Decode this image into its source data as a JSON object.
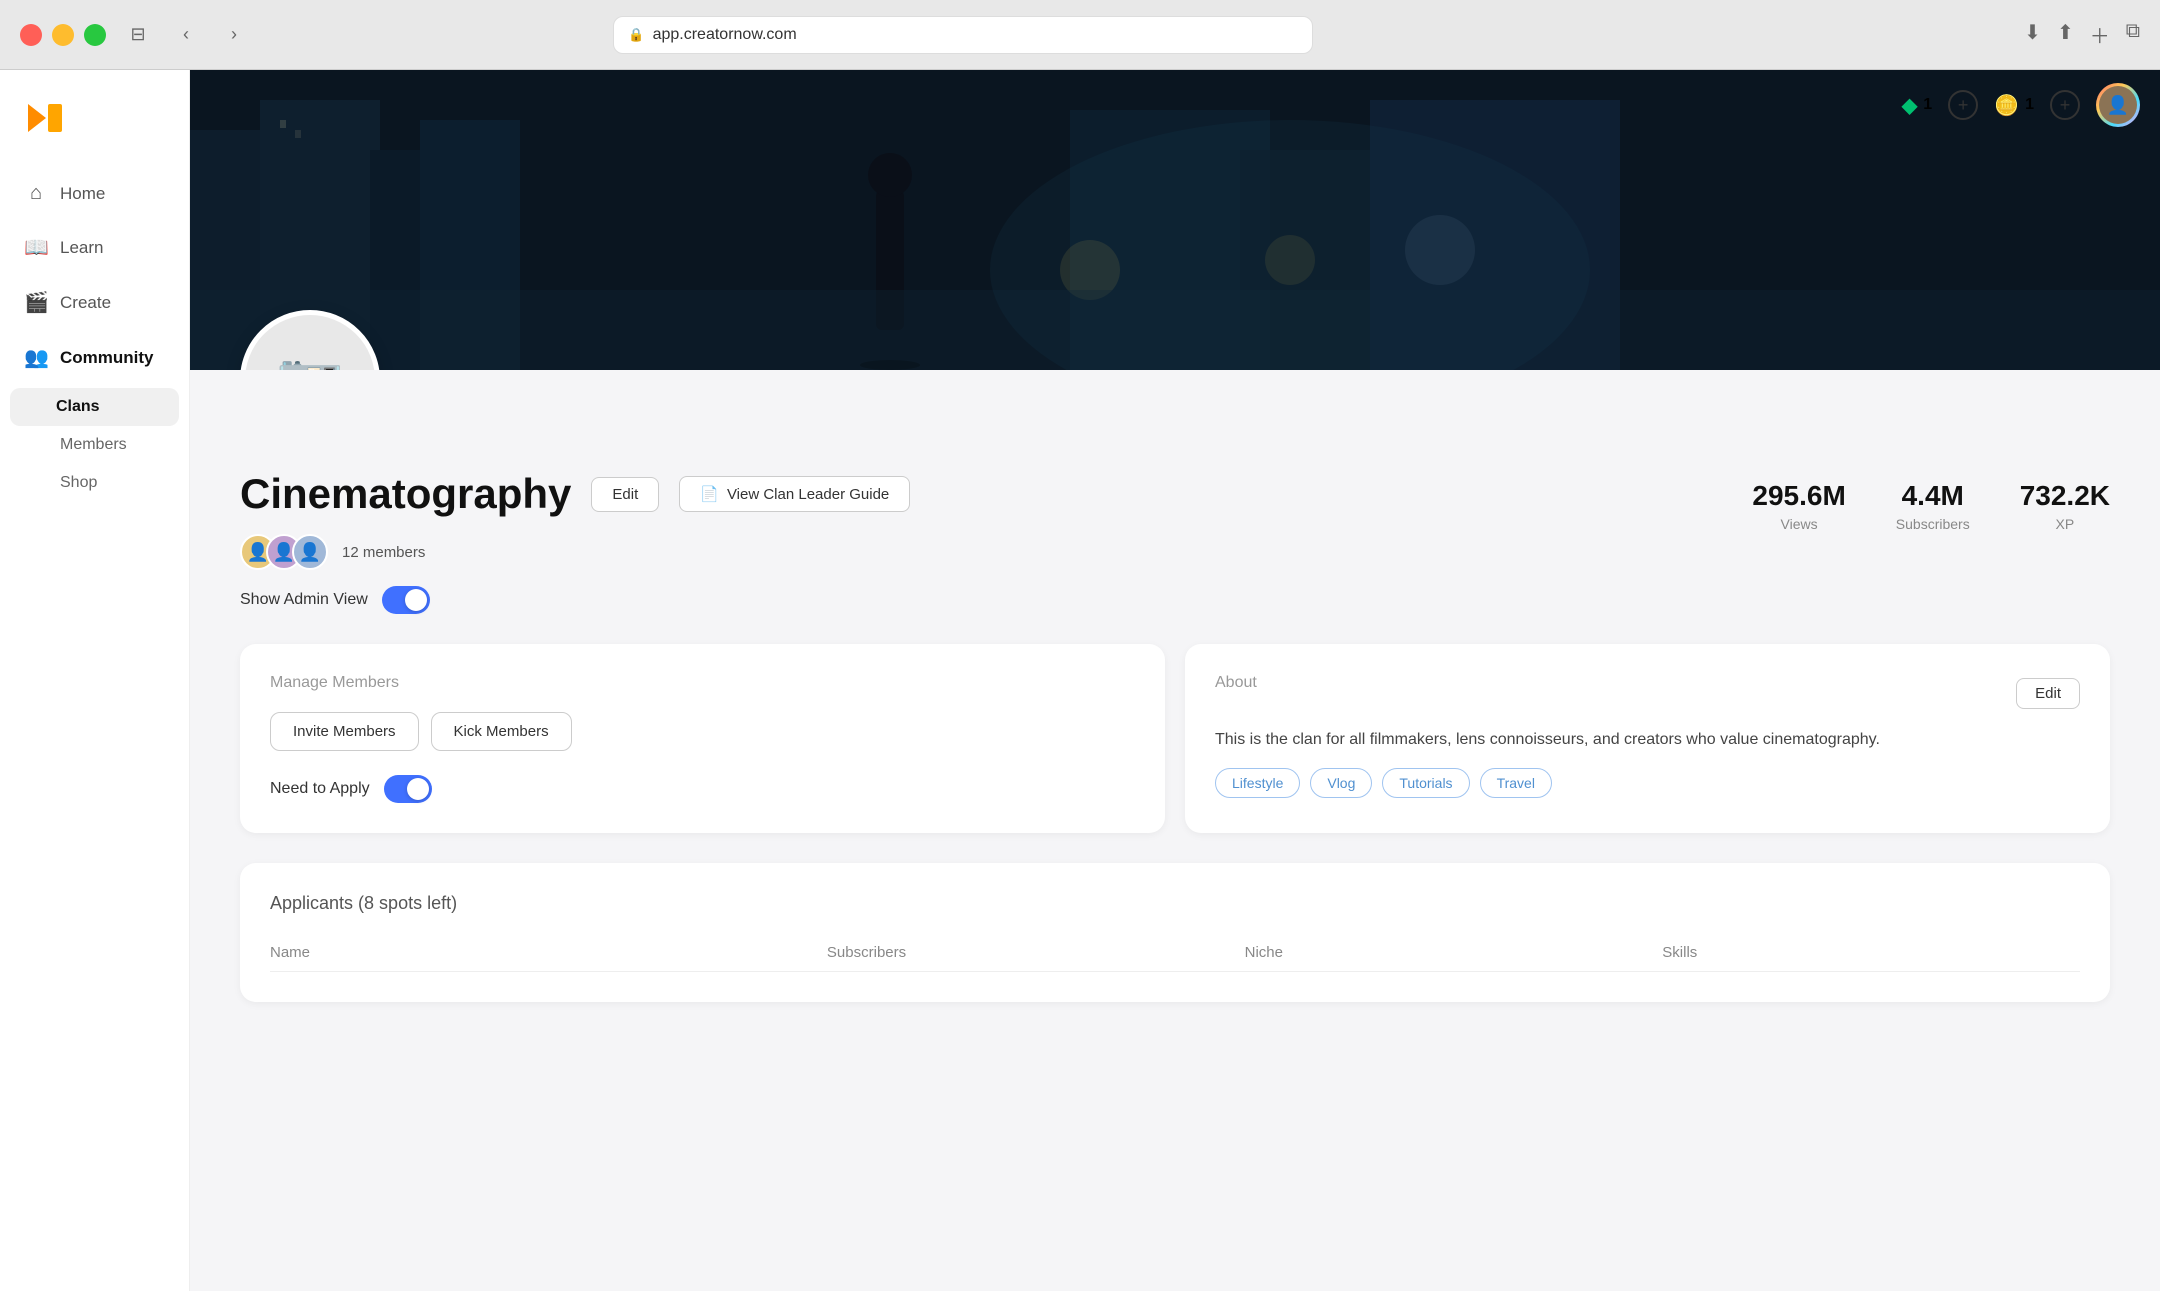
{
  "browser": {
    "url": "app.creatornow.com",
    "back_icon": "‹",
    "forward_icon": "›"
  },
  "header": {
    "logo": "▶",
    "gem_count": "1",
    "coin_count": "1",
    "gem_icon": "◆",
    "coin_icon": "●",
    "add_icon": "+"
  },
  "sidebar": {
    "home_label": "Home",
    "learn_label": "Learn",
    "create_label": "Create",
    "community_label": "Community",
    "clans_label": "Clans",
    "members_label": "Members",
    "shop_label": "Shop"
  },
  "clan": {
    "banner_alt": "Cinematography clan banner",
    "camera_emoji": "📷",
    "name": "Cinematography",
    "edit_btn": "Edit",
    "guide_btn": "View Clan Leader Guide",
    "stats": {
      "views_value": "295.6M",
      "views_label": "Views",
      "subscribers_value": "4.4M",
      "subscribers_label": "Subscribers",
      "xp_value": "732.2K",
      "xp_label": "XP"
    },
    "members_count": "12 members",
    "admin_view_label": "Show Admin View",
    "manage_members_title": "Manage Members",
    "invite_btn": "Invite Members",
    "kick_btn": "Kick Members",
    "need_to_apply_label": "Need to Apply",
    "about_title": "About",
    "about_edit_btn": "Edit",
    "about_description": "This is the clan for all filmmakers, lens connoisseurs, and creators who value cinematography.",
    "tags": [
      "Lifestyle",
      "Vlog",
      "Tutorials",
      "Travel"
    ],
    "applicants_title": "Applicants (8 spots left)",
    "table_headers": [
      "Name",
      "Subscribers",
      "Niche",
      "Skills"
    ]
  }
}
